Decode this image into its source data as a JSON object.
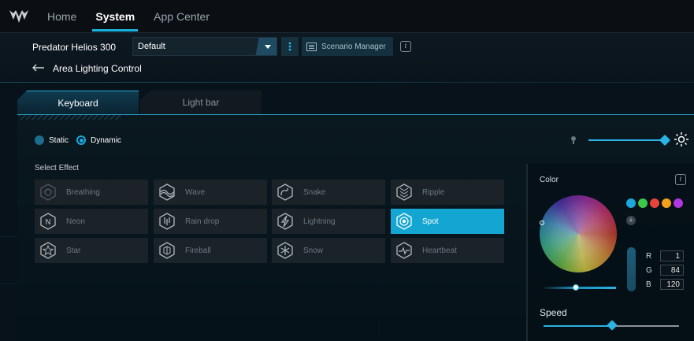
{
  "nav": {
    "tabs": [
      {
        "label": "Home"
      },
      {
        "label": "System"
      },
      {
        "label": "App Center"
      }
    ],
    "active_tab": "System"
  },
  "device": {
    "name": "Predator Helios 300",
    "profile": "Default",
    "scenario_label": "Scenario Manager"
  },
  "breadcrumb": {
    "title": "Area Lighting Control"
  },
  "lighting_tabs": [
    {
      "label": "Keyboard"
    },
    {
      "label": "Light bar"
    }
  ],
  "mode": {
    "static_label": "Static",
    "dynamic_label": "Dynamic",
    "selected": "Dynamic"
  },
  "brightness": {
    "level": 1.0
  },
  "effects": {
    "label": "Select Effect",
    "items": [
      {
        "label": "Breathing",
        "icon": "breathing-icon"
      },
      {
        "label": "Wave",
        "icon": "wave-icon"
      },
      {
        "label": "Snake",
        "icon": "snake-icon"
      },
      {
        "label": "Ripple",
        "icon": "ripple-icon"
      },
      {
        "label": "Neon",
        "icon": "neon-icon"
      },
      {
        "label": "Rain drop",
        "icon": "raindrop-icon"
      },
      {
        "label": "Lightning",
        "icon": "lightning-icon"
      },
      {
        "label": "Spot",
        "icon": "spot-icon"
      },
      {
        "label": "Star",
        "icon": "star-icon"
      },
      {
        "label": "Fireball",
        "icon": "fireball-icon"
      },
      {
        "label": "Snow",
        "icon": "snow-icon"
      },
      {
        "label": "Heartbeat",
        "icon": "heartbeat-icon"
      }
    ],
    "selected": "Spot"
  },
  "color": {
    "title": "Color",
    "swatches": [
      "#1aa9dc",
      "#3cc84a",
      "#e8423a",
      "#f0a21a",
      "#b137e0"
    ],
    "rgb": {
      "r": "1",
      "g": "84",
      "b": "120"
    },
    "labels": {
      "r": "R",
      "g": "G",
      "b": "B"
    }
  },
  "speed": {
    "label": "Speed",
    "level": 0.5
  },
  "colors": {
    "accent": "#18b3df",
    "selected_effect": "#14a6d3",
    "background": "#07121a"
  }
}
